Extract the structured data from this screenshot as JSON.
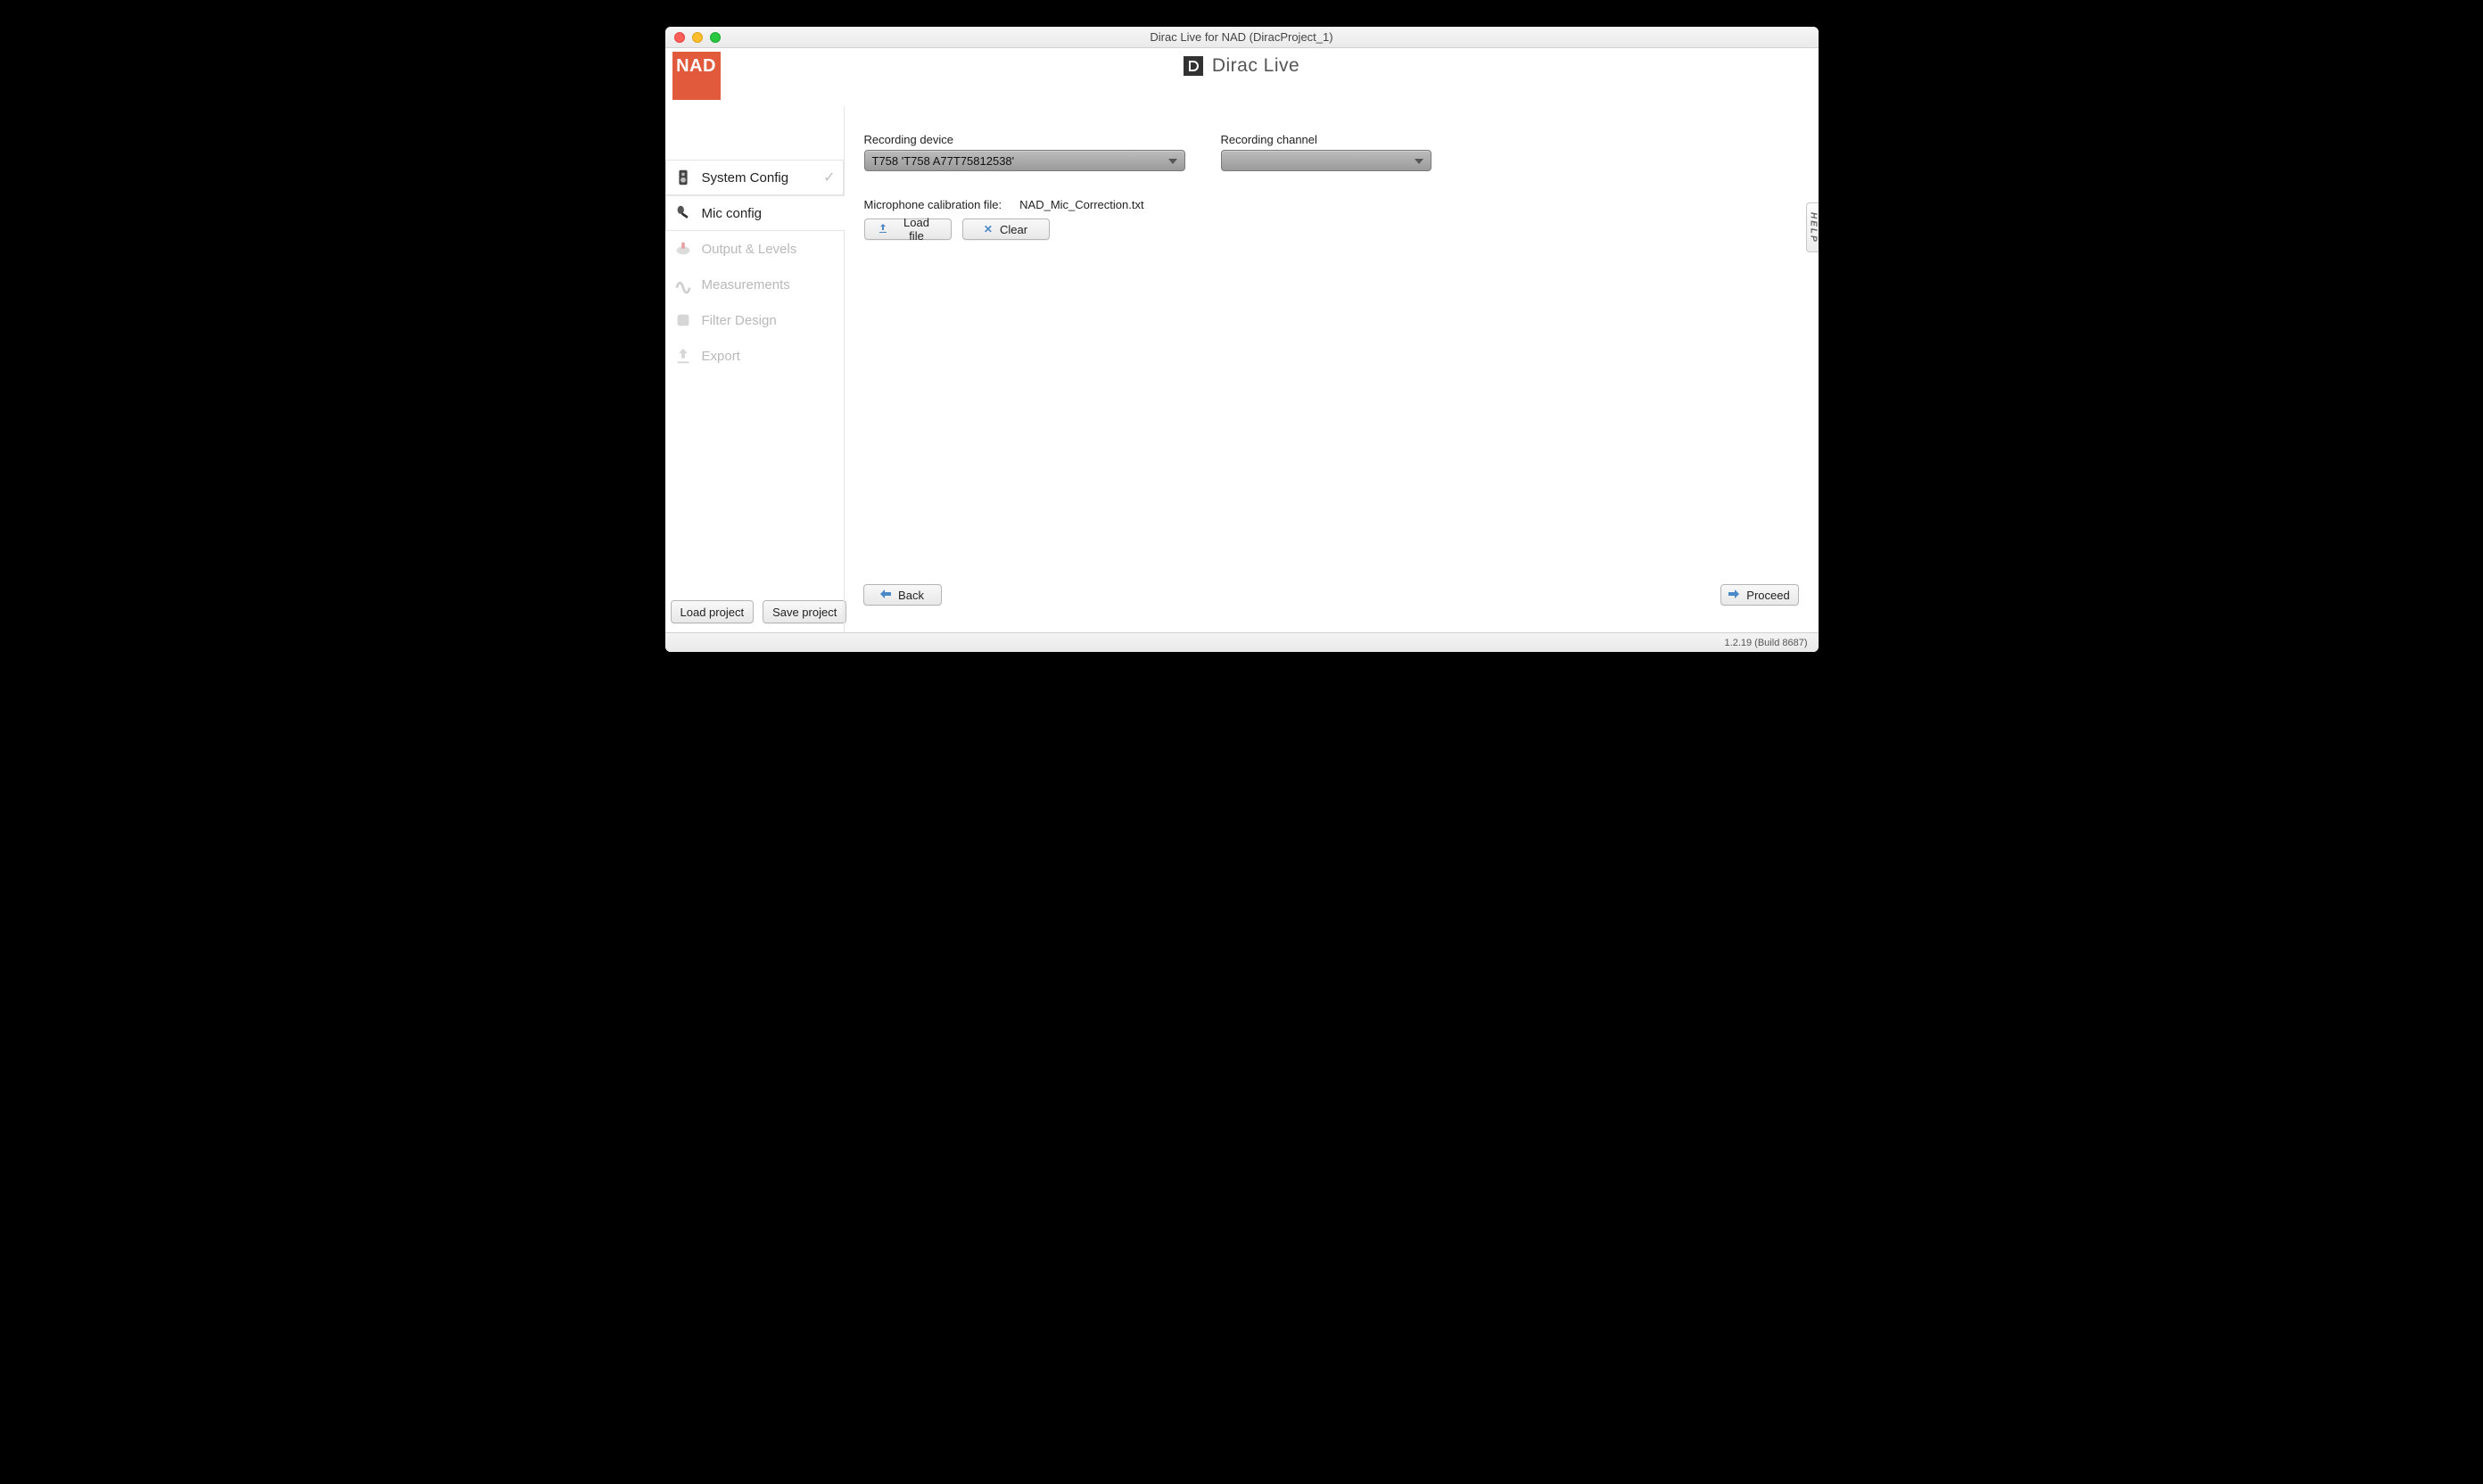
{
  "window": {
    "title": "Dirac Live for NAD (DiracProject_1)"
  },
  "brand": {
    "nad": "NAD",
    "dirac": "Dirac Live"
  },
  "help_tab": "HELP",
  "sidebar": {
    "items": [
      {
        "label": "System Config"
      },
      {
        "label": "Mic config"
      },
      {
        "label": "Output & Levels"
      },
      {
        "label": "Measurements"
      },
      {
        "label": "Filter Design"
      },
      {
        "label": "Export"
      }
    ]
  },
  "content": {
    "recording_device_label": "Recording device",
    "recording_device_value": "T758 'T758 A77T75812538'",
    "recording_channel_label": "Recording channel",
    "recording_channel_value": "",
    "calibration_label": "Microphone calibration file:",
    "calibration_file": "NAD_Mic_Correction.txt",
    "load_file": "Load file",
    "clear": "Clear"
  },
  "nav": {
    "back": "Back",
    "proceed": "Proceed"
  },
  "footer": {
    "load_project": "Load project",
    "save_project": "Save project"
  },
  "status": {
    "version": "1.2.19 (Build 8687)"
  }
}
